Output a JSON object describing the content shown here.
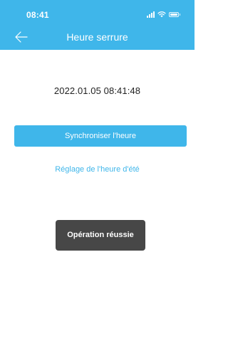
{
  "status_bar": {
    "time": "08:41",
    "icons": [
      "signal-icon",
      "wifi-icon",
      "battery-icon"
    ]
  },
  "header": {
    "title": "Heure serrure",
    "back_icon": "arrow-left-icon"
  },
  "main": {
    "datetime": "2022.01.05 08:41:48",
    "sync_button_label": "Synchroniser l'heure",
    "dst_link_label": "Réglage de l'heure d'été"
  },
  "toast": {
    "message": "Opération réussie"
  },
  "colors": {
    "accent": "#3fb6ea",
    "toast_bg": "#474747",
    "text": "#222222",
    "background": "#ffffff"
  }
}
